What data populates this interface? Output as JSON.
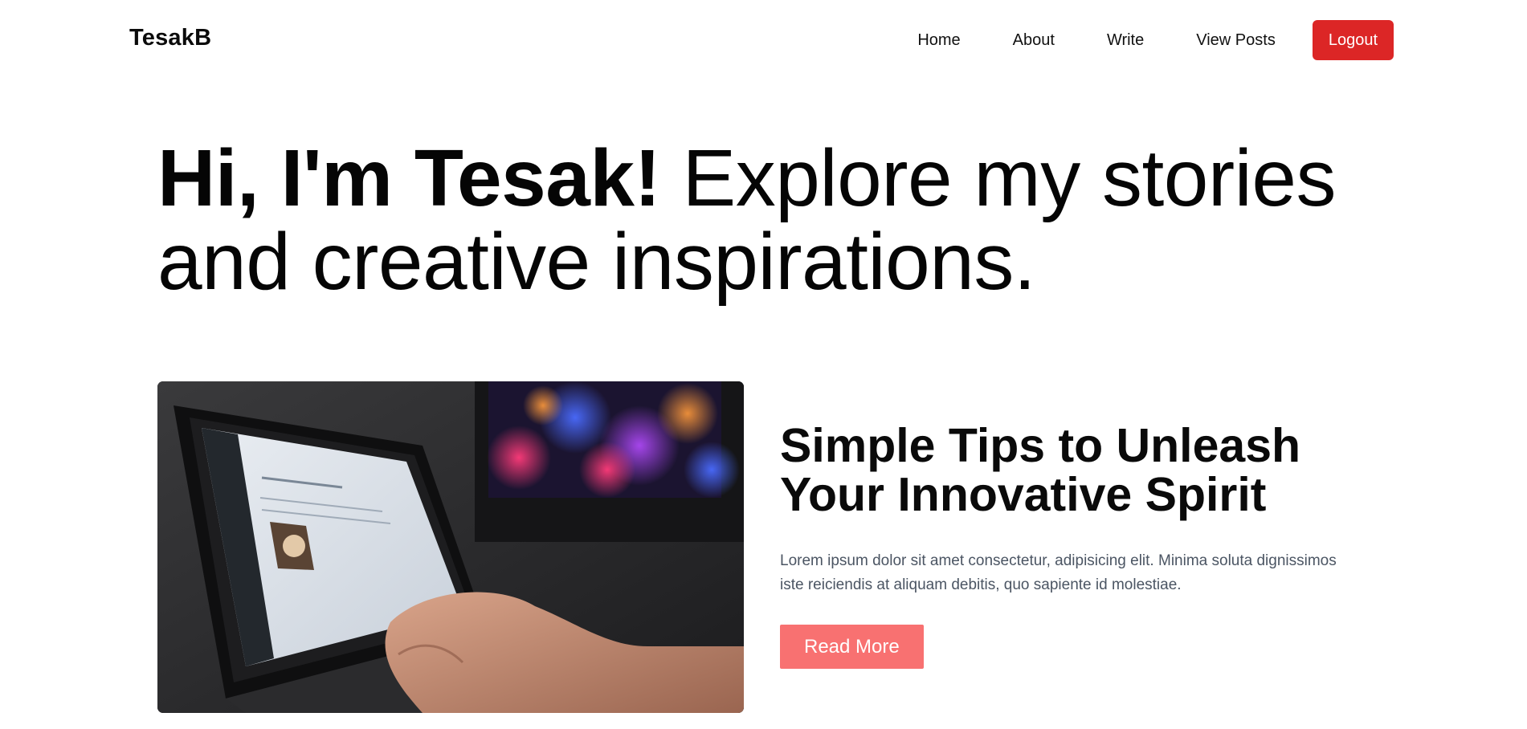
{
  "header": {
    "brand": "TesakB",
    "nav": {
      "home": "Home",
      "about": "About",
      "write": "Write",
      "view_posts": "View Posts",
      "logout": "Logout"
    },
    "logout_color": "#dc2626"
  },
  "hero": {
    "bold": "Hi, I'm Tesak!",
    "rest": " Explore my stories and creative inspirations."
  },
  "featured_post": {
    "image_icon": "laptop-photo",
    "title": "Simple Tips to Unleash Your Innovative Spirit",
    "excerpt": "Lorem ipsum dolor sit amet consectetur, adipisicing elit. Minima soluta dignissimos iste reiciendis at aliquam debitis, quo sapiente id molestiae.",
    "read_more": "Read More",
    "read_more_color": "#f87171"
  }
}
